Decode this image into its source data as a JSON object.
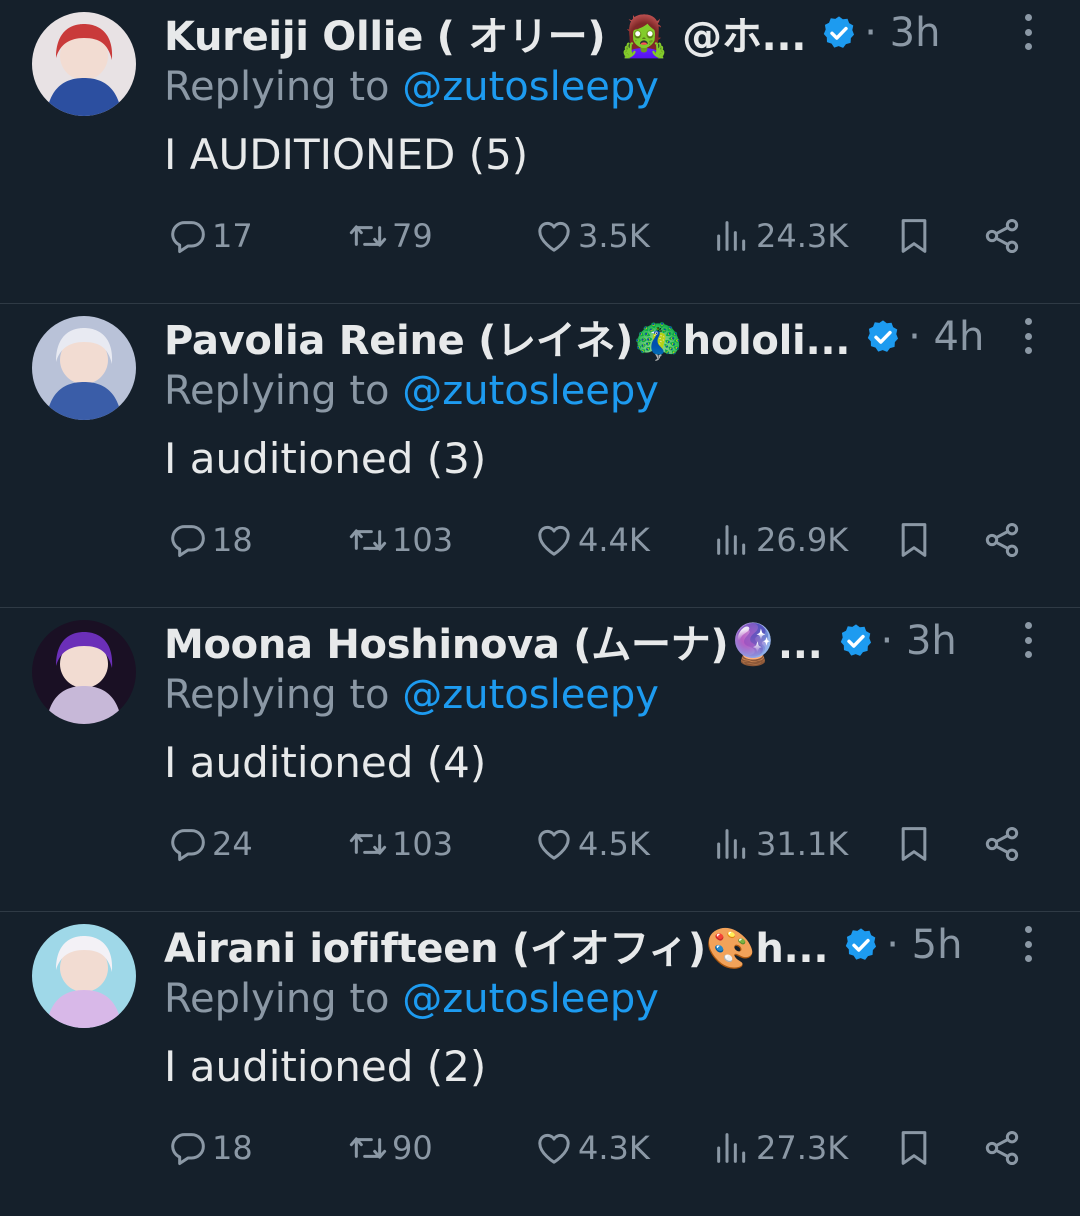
{
  "tweets": [
    {
      "display_name": "Kureiji Ollie ( オリー) 🧟‍♀️ @ホ...",
      "time": "· 3h",
      "replying_prefix": "Replying to ",
      "replying_handle": "@zutosleepy",
      "text": "I AUDITIONED (5)",
      "replies": "17",
      "retweets": "79",
      "likes": "3.5K",
      "views": "24.3K",
      "avatar_colors": [
        "#c93a3a",
        "#e8e2e4",
        "#2c4fa0"
      ]
    },
    {
      "display_name": "Pavolia Reine (レイネ)🦚hololi...",
      "time": "· 4h",
      "replying_prefix": "Replying to ",
      "replying_handle": "@zutosleepy",
      "text": "I auditioned (3)",
      "replies": "18",
      "retweets": "103",
      "likes": "4.4K",
      "views": "26.9K",
      "avatar_colors": [
        "#e8eaf2",
        "#b9c2d8",
        "#3a5da8"
      ]
    },
    {
      "display_name": "Moona Hoshinova (ムーナ)🔮...",
      "time": "· 3h",
      "replying_prefix": "Replying to ",
      "replying_handle": "@zutosleepy",
      "text": "I auditioned (4)",
      "replies": "24",
      "retweets": "103",
      "likes": "4.5K",
      "views": "31.1K",
      "avatar_colors": [
        "#6b2fb8",
        "#1a1024",
        "#c7b8d8"
      ]
    },
    {
      "display_name": "Airani iofifteen (イオフィ)🎨h...",
      "time": "· 5h",
      "replying_prefix": "Replying to ",
      "replying_handle": "@zutosleepy",
      "text": "I auditioned (2)",
      "replies": "18",
      "retweets": "90",
      "likes": "4.3K",
      "views": "27.3K",
      "avatar_colors": [
        "#f3f1f6",
        "#9fd8e8",
        "#d8b8e8"
      ]
    }
  ],
  "icons": {
    "reply": "reply-icon",
    "retweet": "retweet-icon",
    "like": "heart-icon",
    "views": "views-icon",
    "bookmark": "bookmark-icon",
    "share": "share-icon",
    "verified": "verified-badge-icon",
    "more": "more-options-icon"
  },
  "colors": {
    "background": "#15202b",
    "text": "#e7e9ea",
    "muted": "#8b98a5",
    "accent": "#1d9bf0"
  }
}
